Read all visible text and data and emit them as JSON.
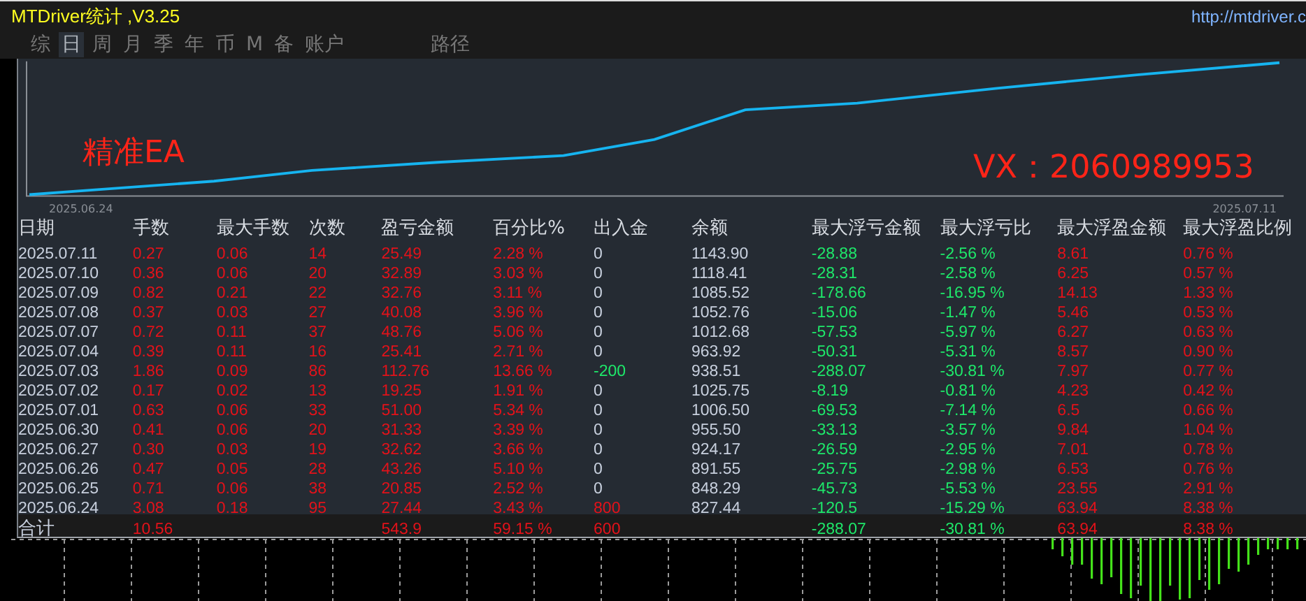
{
  "window": {
    "title": "MTDriver统计 ,V3.25",
    "url": "http://mtdriver.c"
  },
  "tabs": [
    {
      "label": "综",
      "selected": false
    },
    {
      "label": "日",
      "selected": true
    },
    {
      "label": "周",
      "selected": false
    },
    {
      "label": "月",
      "selected": false
    },
    {
      "label": "季",
      "selected": false
    },
    {
      "label": "年",
      "selected": false
    },
    {
      "label": "币",
      "selected": false
    },
    {
      "label": "M",
      "selected": false
    },
    {
      "label": "备",
      "selected": false
    },
    {
      "label": "账户",
      "selected": false
    },
    {
      "label": "路径",
      "selected": false
    }
  ],
  "equity_chart": {
    "start_date": "2025.06.24",
    "end_date": "2025.07.11",
    "overlay_left": "精准EA",
    "overlay_right": "VX：2060989953"
  },
  "table": {
    "columns": [
      {
        "label": "日期",
        "kind": "plain",
        "in_total": true
      },
      {
        "label": "手数",
        "kind": "red",
        "in_total": true
      },
      {
        "label": "最大手数",
        "kind": "red",
        "in_total": false
      },
      {
        "label": "次数",
        "kind": "red",
        "in_total": false
      },
      {
        "label": "盈亏金额",
        "kind": "red",
        "in_total": true
      },
      {
        "label": "百分比%",
        "kind": "red",
        "in_total": true
      },
      {
        "label": "出入金",
        "kind": "signed",
        "in_total": true
      },
      {
        "label": "余额",
        "kind": "plain",
        "in_total": false
      },
      {
        "label": "最大浮亏金额",
        "kind": "green",
        "in_total": true
      },
      {
        "label": "最大浮亏比",
        "kind": "green",
        "in_total": true
      },
      {
        "label": "最大浮盈金额",
        "kind": "red",
        "in_total": true
      },
      {
        "label": "最大浮盈比例",
        "kind": "red",
        "in_total": true
      }
    ],
    "rows": [
      [
        "2025.07.11",
        "0.27",
        "0.06",
        "14",
        "25.49",
        "2.28 %",
        "0",
        "1143.90",
        "-28.88",
        "-2.56 %",
        "8.61",
        "0.76 %"
      ],
      [
        "2025.07.10",
        "0.36",
        "0.06",
        "20",
        "32.89",
        "3.03 %",
        "0",
        "1118.41",
        "-28.31",
        "-2.58 %",
        "6.25",
        "0.57 %"
      ],
      [
        "2025.07.09",
        "0.82",
        "0.21",
        "22",
        "32.76",
        "3.11 %",
        "0",
        "1085.52",
        "-178.66",
        "-16.95 %",
        "14.13",
        "1.33 %"
      ],
      [
        "2025.07.08",
        "0.37",
        "0.03",
        "27",
        "40.08",
        "3.96 %",
        "0",
        "1052.76",
        "-15.06",
        "-1.47 %",
        "5.46",
        "0.53 %"
      ],
      [
        "2025.07.07",
        "0.72",
        "0.11",
        "37",
        "48.76",
        "5.06 %",
        "0",
        "1012.68",
        "-57.53",
        "-5.97 %",
        "6.27",
        "0.63 %"
      ],
      [
        "2025.07.04",
        "0.39",
        "0.11",
        "16",
        "25.41",
        "2.71 %",
        "0",
        "963.92",
        "-50.31",
        "-5.31 %",
        "8.57",
        "0.90 %"
      ],
      [
        "2025.07.03",
        "1.86",
        "0.09",
        "86",
        "112.76",
        "13.66 %",
        "-200",
        "938.51",
        "-288.07",
        "-30.81 %",
        "7.97",
        "0.77 %"
      ],
      [
        "2025.07.02",
        "0.17",
        "0.02",
        "13",
        "19.25",
        "1.91 %",
        "0",
        "1025.75",
        "-8.19",
        "-0.81 %",
        "4.23",
        "0.42 %"
      ],
      [
        "2025.07.01",
        "0.63",
        "0.06",
        "33",
        "51.00",
        "5.34 %",
        "0",
        "1006.50",
        "-69.53",
        "-7.14 %",
        "6.5",
        "0.66 %"
      ],
      [
        "2025.06.30",
        "0.41",
        "0.06",
        "20",
        "31.33",
        "3.39 %",
        "0",
        "955.50",
        "-33.13",
        "-3.57 %",
        "9.84",
        "1.04 %"
      ],
      [
        "2025.06.27",
        "0.30",
        "0.03",
        "19",
        "32.62",
        "3.66 %",
        "0",
        "924.17",
        "-26.59",
        "-2.95 %",
        "7.01",
        "0.78 %"
      ],
      [
        "2025.06.26",
        "0.47",
        "0.05",
        "28",
        "43.26",
        "5.10 %",
        "0",
        "891.55",
        "-25.75",
        "-2.98 %",
        "6.53",
        "0.76 %"
      ],
      [
        "2025.06.25",
        "0.71",
        "0.06",
        "38",
        "20.85",
        "2.52 %",
        "0",
        "848.29",
        "-45.73",
        "-5.53 %",
        "23.55",
        "2.91 %"
      ],
      [
        "2025.06.24",
        "3.08",
        "0.18",
        "95",
        "27.44",
        "3.43 %",
        "800",
        "827.44",
        "-120.5",
        "-15.29 %",
        "63.94",
        "8.38 %"
      ]
    ],
    "total": [
      "合计",
      "10.56",
      "543.9",
      "59.15 %",
      "600",
      "-288.07",
      "-30.81 %",
      "63.94",
      "8.38 %"
    ]
  }
}
